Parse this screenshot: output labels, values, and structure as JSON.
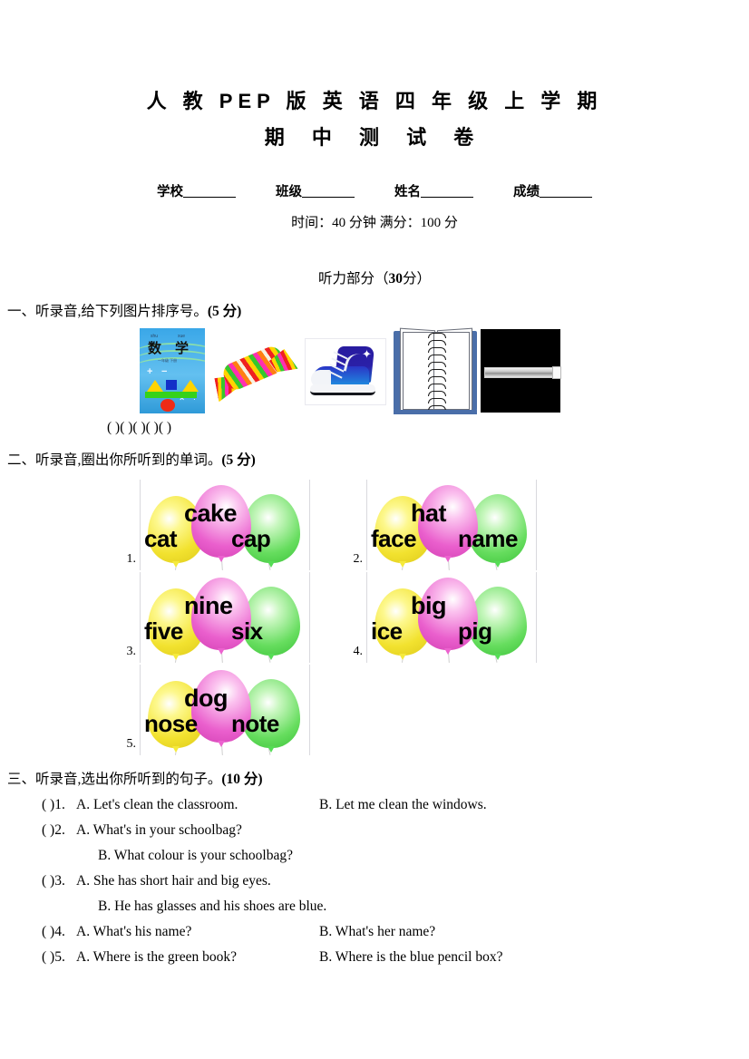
{
  "header": {
    "title_line_1": "人 教 PEP 版 英 语 四 年 级 上 学 期",
    "title_line_2": "期 中 测 试 卷",
    "fields": [
      {
        "label": "学校"
      },
      {
        "label": "班级"
      },
      {
        "label": "姓名"
      },
      {
        "label": "成绩"
      }
    ],
    "time_line": "时间：40 分钟  满分：100 分"
  },
  "listening_part": {
    "heading_text": "听力部分（",
    "heading_points": "30",
    "heading_suffix": "分）"
  },
  "q1": {
    "heading": "一、听录音,给下列图片排序号。",
    "points": "(5 分)",
    "pictures": [
      {
        "name": "math-textbook",
        "pinyin_left": "shu",
        "pinyin_right": "xue",
        "cn_left": "数",
        "cn_right": "学",
        "subtitle": "一年级 下册",
        "op_add": "+",
        "op_sub": "−",
        "op_mul": "×",
        "op_div": "÷"
      },
      {
        "name": "candy"
      },
      {
        "name": "sneaker"
      },
      {
        "name": "spiral-notebook"
      },
      {
        "name": "ruler"
      }
    ],
    "answer_brackets": [
      "(    )",
      "(    )",
      "(    )",
      "(    )",
      "(    )"
    ]
  },
  "q2": {
    "heading": "二、听录音,圈出你所听到的单词。",
    "points": "(5 分)",
    "items": [
      {
        "num": "1.",
        "left": "cat",
        "mid": "cake",
        "right": "cap"
      },
      {
        "num": "2.",
        "left": "face",
        "mid": "hat",
        "right": "name"
      },
      {
        "num": "3.",
        "left": "five",
        "mid": "nine",
        "right": "six"
      },
      {
        "num": "4.",
        "left": "ice",
        "mid": "big",
        "right": "pig"
      },
      {
        "num": "5.",
        "left": "nose",
        "mid": "dog",
        "right": "note"
      }
    ]
  },
  "q3": {
    "heading": "三、听录音,选出你所听到的句子。",
    "points": "(10 分)",
    "items": [
      {
        "bracket": "(    )1.",
        "option_a": "A. Let's clean the classroom.",
        "option_b": "B. Let me clean the windows.",
        "two_line": false
      },
      {
        "bracket": "(    )2.",
        "option_a": "A. What's in your schoolbag?",
        "option_b": "B.  What colour is your schoolbag?",
        "two_line": true
      },
      {
        "bracket": "(    )3.",
        "option_a": "A. She has short hair and big eyes.",
        "option_b": "B. He has glasses and his shoes are blue.",
        "two_line": true
      },
      {
        "bracket": "(    )4.",
        "option_a": "A. What's his name?",
        "option_b": "B. What's her name?",
        "two_line": false
      },
      {
        "bracket": "(    )5.",
        "option_a": "A. Where is the green book?",
        "option_b": "B. Where is the blue pencil box?",
        "two_line": false
      }
    ]
  },
  "colors": {
    "balloon_yellow": "#f2e22f",
    "balloon_pink": "#ea5fcd",
    "balloon_green": "#66dd5e",
    "page_background": "#ffffff",
    "text": "#000000"
  }
}
